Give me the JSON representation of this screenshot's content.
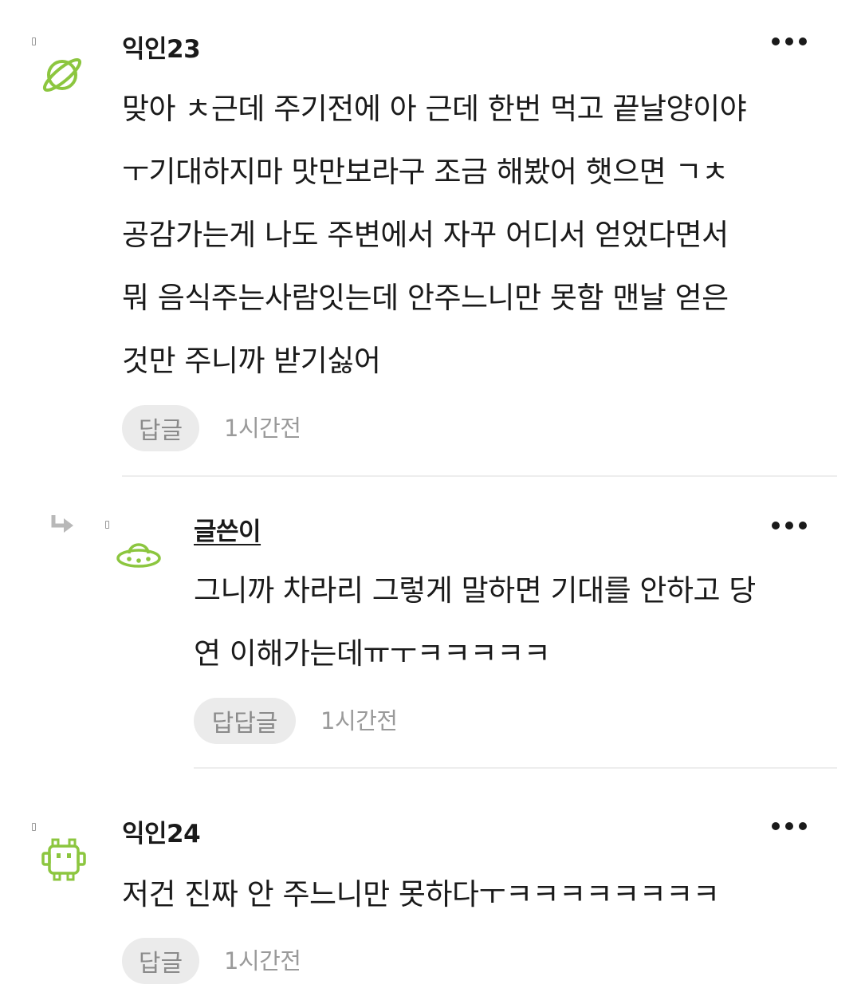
{
  "comments": [
    {
      "author": "익인23",
      "avatar_icon": "planet-icon",
      "text": "맞아 ㅊ근데 주기전에 아 근데 한번 먹고 끝날양이야\nㅜ기대하지마 맛만보라구 조금 해봤어 햇으면 ㄱㅊ\n공감가는게 나도 주변에서 자꾸 어디서 얻었다면서\n뭐 음식주는사람잇는데 안주느니만 못함 맨날 얻은\n것만 주니까 받기싫어",
      "reply_label": "답글",
      "time": "1시간전"
    },
    {
      "author": "글쓴이",
      "avatar_icon": "ufo-icon",
      "text": "그니까 차라리 그렇게 말하면 기대를 안하고 당\n연 이해가는데ㅠㅜㅋㅋㅋㅋㅋ",
      "reply_label": "답답글",
      "time": "1시간전"
    },
    {
      "author": "익인24",
      "avatar_icon": "space-invader-icon",
      "text": "저건 진짜 안 주느니만 못하다ㅜㅋㅋㅋㅋㅋㅋㅋㅋ",
      "reply_label": "답글",
      "time": "1시간전"
    }
  ],
  "colors": {
    "avatar_green": "#8cc63f",
    "reply_bg": "#ebebeb",
    "meta_gray": "#9a9a9a"
  }
}
